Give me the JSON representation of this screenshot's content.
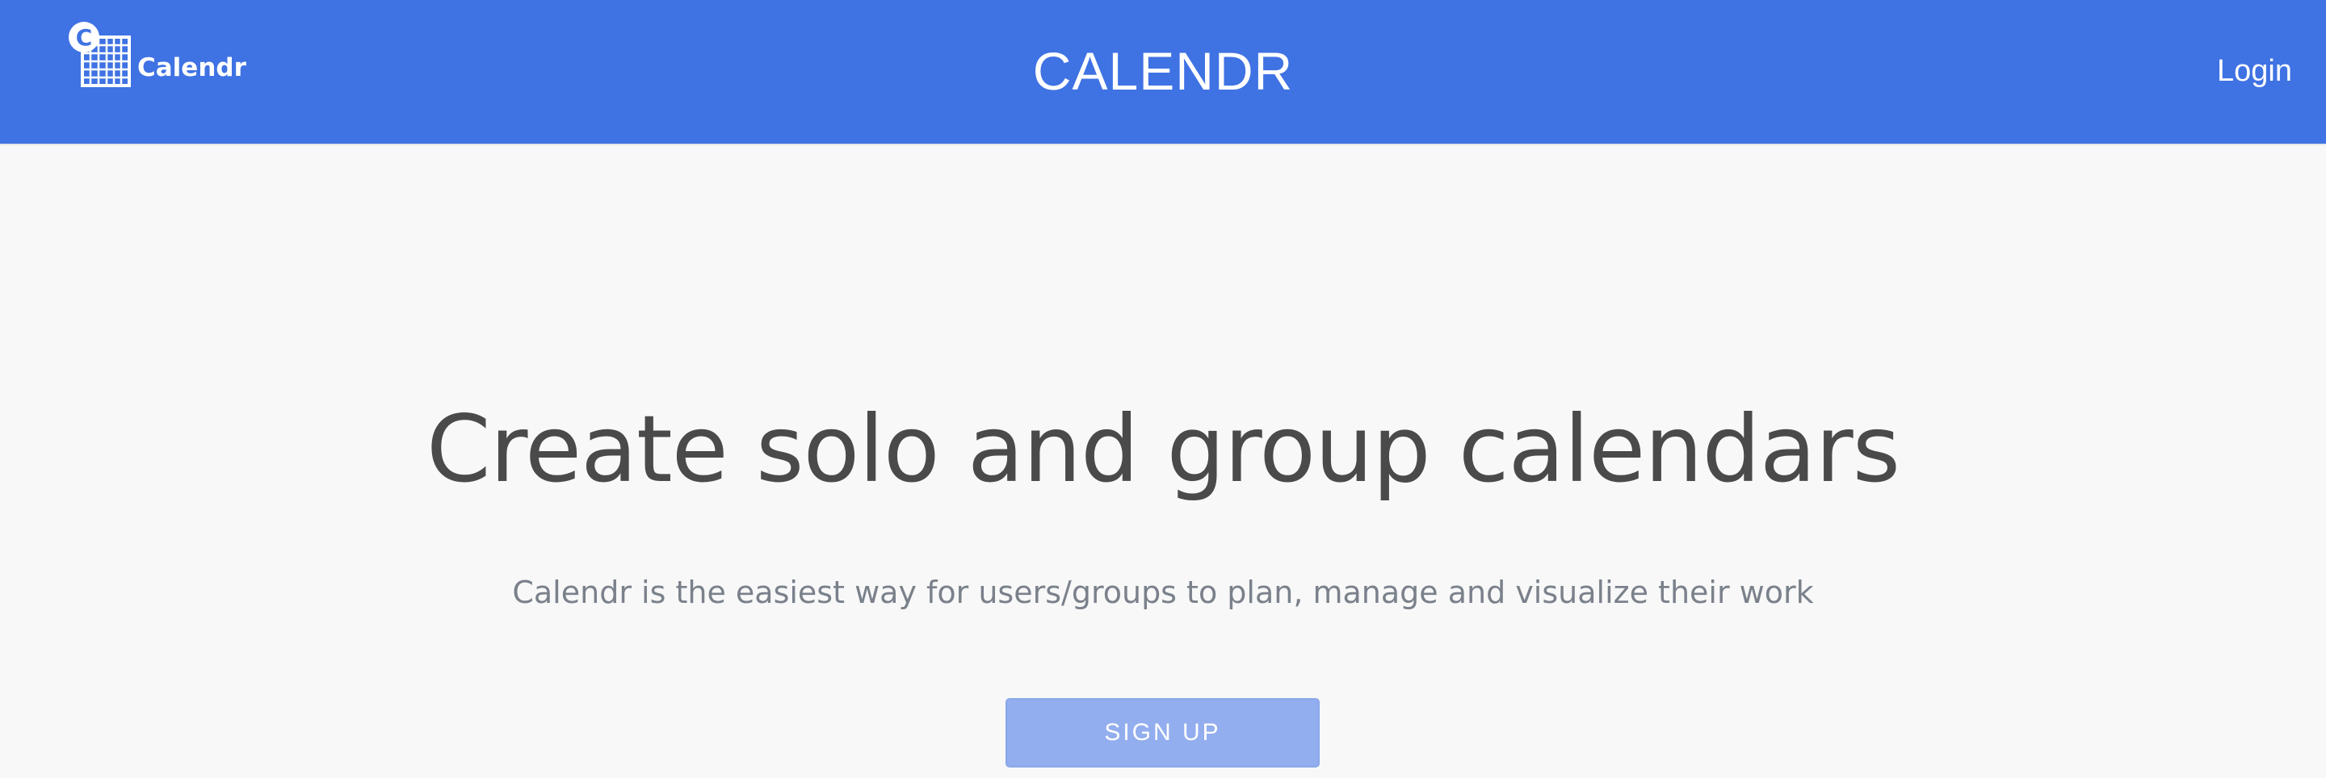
{
  "navbar": {
    "brand_label": "Calendr",
    "brand_icon": "calendar-grid-icon",
    "brand_icon_letter": "C",
    "title": "CALENDR",
    "login_label": "Login"
  },
  "hero": {
    "title": "Create solo and group calendars",
    "subtitle": "Calendr is the easiest way for users/groups to plan, manage and visualize their work",
    "signup_label": "SIGN UP"
  },
  "colors": {
    "navbar_background": "#3f72e3",
    "page_background": "#f8f8f8",
    "signup_button": "#93aeee",
    "title_text": "#4a4a4a",
    "subtitle_text": "#7a818b"
  }
}
